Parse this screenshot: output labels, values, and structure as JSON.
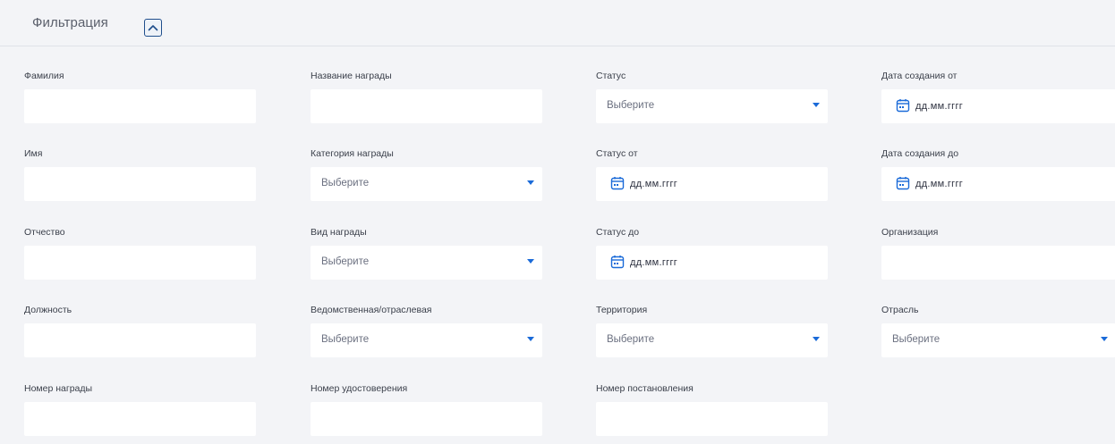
{
  "header": {
    "title": "Фильтрация",
    "collapse_icon": "chevron-up-icon"
  },
  "colors": {
    "accent": "#1a6ad8",
    "border_accent": "#1f4e8c",
    "background": "#f3f4f7",
    "field_bg": "#ffffff"
  },
  "fields": {
    "surname": {
      "label": "Фамилия",
      "value": ""
    },
    "award_name": {
      "label": "Название награды",
      "value": ""
    },
    "status": {
      "label": "Статус",
      "value": "Выберите"
    },
    "created_from": {
      "label": "Дата создания от",
      "placeholder": "дд.мм.гггг"
    },
    "name": {
      "label": "Имя",
      "value": ""
    },
    "award_category": {
      "label": "Категория награды",
      "value": "Выберите"
    },
    "status_from": {
      "label": "Статус от",
      "placeholder": "дд.мм.гггг"
    },
    "created_to": {
      "label": "Дата создания до",
      "placeholder": "дд.мм.гггг"
    },
    "patronymic": {
      "label": "Отчество",
      "value": ""
    },
    "award_type": {
      "label": "Вид награды",
      "value": "Выберите"
    },
    "status_to": {
      "label": "Статус до",
      "placeholder": "дд.мм.гггг"
    },
    "organization": {
      "label": "Организация",
      "value": ""
    },
    "position": {
      "label": "Должность",
      "value": ""
    },
    "departmental": {
      "label": "Ведомственная/отраслевая",
      "value": "Выберите"
    },
    "territory": {
      "label": "Территория",
      "value": "Выберите"
    },
    "industry": {
      "label": "Отрасль",
      "value": "Выберите"
    },
    "award_number": {
      "label": "Номер награды",
      "value": ""
    },
    "certificate_number": {
      "label": "Номер удостоверения",
      "value": ""
    },
    "resolution_number": {
      "label": "Номер постановления",
      "value": ""
    }
  }
}
